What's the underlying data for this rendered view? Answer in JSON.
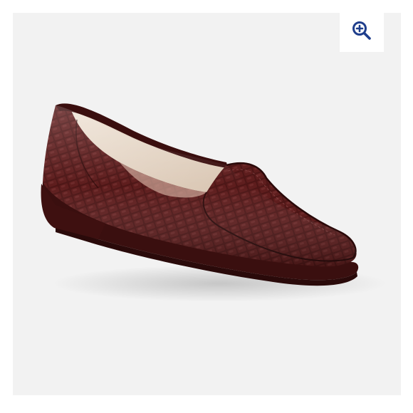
{
  "product_viewer": {
    "zoom_icon": "zoom-in-magnifier-icon",
    "image": "brown-croc-embossed-loafer",
    "colors": {
      "background": "#f2f2f2",
      "leather": "#4a1414",
      "zoom_icon": "#1f3e8c"
    }
  }
}
